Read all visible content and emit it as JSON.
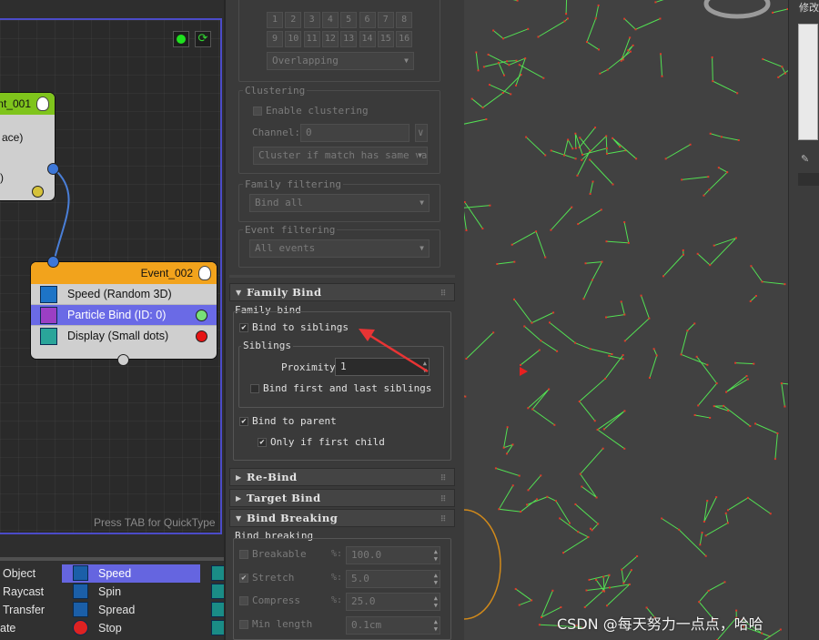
{
  "particle_view": {
    "event1": {
      "title": "ent_001",
      "row1": "ace)",
      "row2": ")"
    },
    "event2": {
      "title": "Event_002",
      "operators": [
        {
          "label": "Speed (Random 3D)",
          "icon": "speed-icon"
        },
        {
          "label": "Particle Bind (ID: 0)",
          "icon": "particle-bind-icon",
          "port": "#78e078"
        },
        {
          "label": "Display (Small dots)",
          "icon": "display-icon",
          "port": "#e61414"
        }
      ]
    },
    "hint": "Press TAB for QuickType"
  },
  "depot": [
    {
      "label": "Object"
    },
    {
      "label": "Raycast"
    },
    {
      "label": "Transfer"
    },
    {
      "label": "ate"
    },
    {
      "label": "Speed",
      "icon": "speed-icon"
    },
    {
      "label": "Spin",
      "icon": "spin-icon"
    },
    {
      "label": "Spread",
      "icon": "spread-icon"
    },
    {
      "label": "Stop",
      "icon": "stop-icon"
    }
  ],
  "panel": {
    "num_buttons": [
      "1",
      "2",
      "3",
      "4",
      "5",
      "6",
      "7",
      "8",
      "9",
      "10",
      "11",
      "12",
      "13",
      "14",
      "15",
      "16"
    ],
    "overlapping": "Overlapping",
    "clustering": {
      "label": "Clustering",
      "enable": "Enable clustering",
      "channel_label": "Channel:",
      "channel_value": "0",
      "cluster_mode": "Cluster if match has same val"
    },
    "family_filtering": {
      "label": "Family filtering",
      "value": "Bind all"
    },
    "event_filtering": {
      "label": "Event filtering",
      "value": "All events"
    },
    "family_bind": {
      "rollout": "Family Bind",
      "group": "Family bind",
      "bind_siblings": "Bind to siblings",
      "siblings": "Siblings",
      "proximity_label": "Proximity",
      "proximity_value": "1",
      "bind_first_last": "Bind first and last siblings",
      "bind_parent": "Bind to parent",
      "only_first_child": "Only if first child"
    },
    "rebind": "Re-Bind",
    "target_bind": "Target Bind",
    "bind_breaking": {
      "rollout": "Bind Breaking",
      "group": "Bind breaking",
      "rows": [
        {
          "label": "Breakable",
          "unit": "%:",
          "value": "100.0"
        },
        {
          "label": "Stretch",
          "unit": "%:",
          "value": "5.0"
        },
        {
          "label": "Compress",
          "unit": "%:",
          "value": "25.0"
        },
        {
          "label": "Min length",
          "unit": "",
          "value": "0.1cm"
        }
      ]
    }
  },
  "right_panel": {
    "tab_title": "修改"
  },
  "watermark": "CSDN @每天努力一点点，哈哈",
  "colors": {
    "accent": "#4b4bc8",
    "selected": "#6a6ae6",
    "event1_head": "#7fc41c",
    "event2_head": "#f2a31c",
    "arrow": "#e83434",
    "particles": "#53e053"
  }
}
